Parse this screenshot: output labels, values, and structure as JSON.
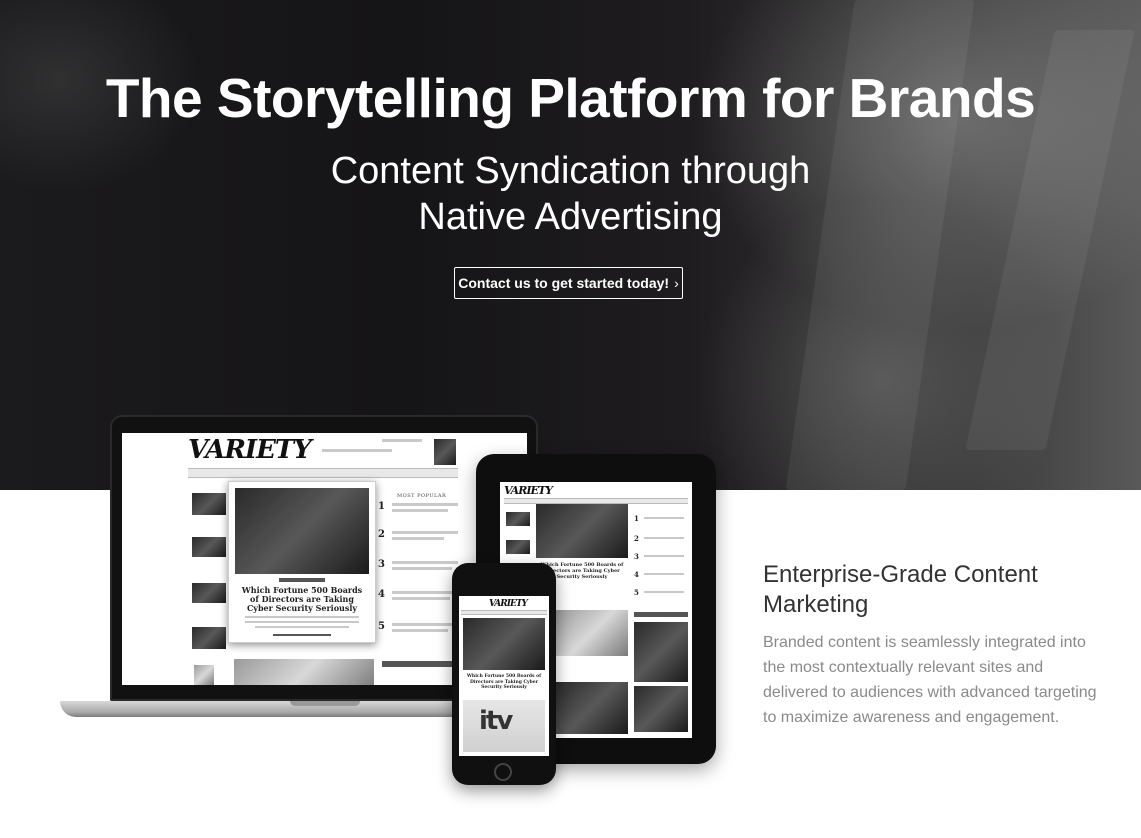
{
  "hero": {
    "title": "The Storytelling Platform for Brands",
    "subtitle_line1": "Content Syndication through",
    "subtitle_line2": "Native Advertising",
    "cta_label": "Contact us to get started today!",
    "cta_chevron": "›"
  },
  "devices": {
    "laptop": {
      "site_logo": "VARIETY",
      "card_headline": "Which Fortune 500 Boards of Directors are Taking Cyber Security Seriously",
      "section_title": "MOST POPULAR",
      "list_numbers": [
        "1",
        "2",
        "3",
        "4",
        "5"
      ]
    },
    "tablet": {
      "site_logo": "VARIETY",
      "card_headline": "Which Fortune 500 Boards of Directors are Taking Cyber Security Seriously",
      "list_numbers": [
        "1",
        "2",
        "3",
        "4",
        "5"
      ]
    },
    "phone": {
      "site_logo": "VARIETY",
      "card_headline": "Which Fortune 500 Boards of Directors are Taking Cyber Security Seriously",
      "ad_logo": "itv"
    }
  },
  "feature": {
    "title": "Enterprise-Grade Content Marketing",
    "body": "Branded content is seamlessly integrated into the most contextually relevant sites and delivered to audiences with advanced targeting to maximize awareness and engagement."
  },
  "colors": {
    "hero_bg": "#1b1a1c",
    "heading_text": "#333333",
    "body_text": "#8a8a8a",
    "cta_border": "#ffffff"
  }
}
